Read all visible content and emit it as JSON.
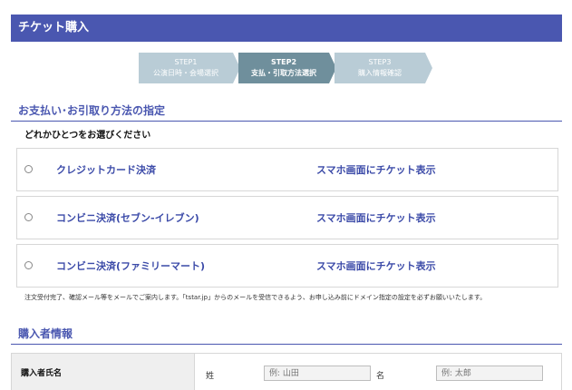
{
  "header": {
    "title": "チケット購入"
  },
  "steps": [
    {
      "label": "STEP1",
      "desc": "公演日時・会場選択"
    },
    {
      "label": "STEP2",
      "desc": "支払・引取方法選択"
    },
    {
      "label": "STEP3",
      "desc": "購入情報確認"
    }
  ],
  "payment": {
    "section_title": "お支払い･お引取り方法の指定",
    "instruction": "どれかひとつをお選びください",
    "options": [
      {
        "label": "クレジットカード決済",
        "delivery": "スマホ画面にチケット表示"
      },
      {
        "label": "コンビニ決済(セブン-イレブン)",
        "delivery": "スマホ画面にチケット表示"
      },
      {
        "label": "コンビニ決済(ファミリーマート)",
        "delivery": "スマホ画面にチケット表示"
      }
    ],
    "notice": "注文受付完了、確認メール等をメールでご案内します。「tstar.jp」からのメールを受信できるよう、お申し込み前にドメイン指定の設定を必ずお願いいたします。"
  },
  "buyer": {
    "section_title": "購入者情報",
    "name_label": "購入者氏名",
    "sei_label": "姓",
    "sei_placeholder": "例: 山田",
    "mei_label": "名",
    "mei_placeholder": "例: 太郎"
  }
}
